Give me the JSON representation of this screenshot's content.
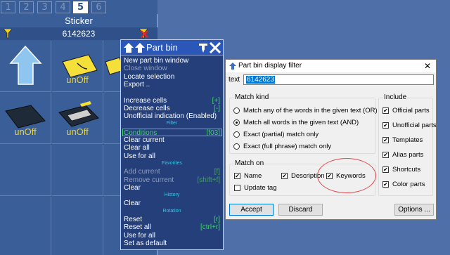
{
  "partbin": {
    "tabs": [
      "1",
      "2",
      "3",
      "4",
      "5",
      "6"
    ],
    "active_tab": "5",
    "title": "Sticker",
    "filter_text": "6142623",
    "cells": [
      {
        "caption": ""
      },
      {
        "caption": "unOff"
      },
      {
        "caption": ""
      },
      {
        "caption": "unOff"
      },
      {
        "caption": "unOff"
      }
    ]
  },
  "menu": {
    "title": "Part bin",
    "items": [
      {
        "label": "New part bin window",
        "shortcut": "",
        "state": "normal"
      },
      {
        "label": "Close window",
        "shortcut": "",
        "state": "disabled"
      },
      {
        "label": "Locate selection",
        "shortcut": "",
        "state": "normal"
      },
      {
        "label": "Export ..",
        "shortcut": "",
        "state": "normal"
      },
      {
        "label": "",
        "shortcut": "",
        "state": "blank"
      },
      {
        "label": "Increase cells",
        "shortcut": "[+]",
        "state": "normal"
      },
      {
        "label": "Decrease cells",
        "shortcut": "[-]",
        "state": "normal"
      },
      {
        "label": "Unofficial indication (Enabled)",
        "shortcut": "",
        "state": "normal"
      },
      {
        "label": "Filter",
        "shortcut": "",
        "state": "separator"
      },
      {
        "label": "Conditions",
        "shortcut": "[f03]",
        "state": "selected"
      },
      {
        "label": "Clear current",
        "shortcut": "",
        "state": "normal"
      },
      {
        "label": "Clear all",
        "shortcut": "",
        "state": "normal"
      },
      {
        "label": "Use for all",
        "shortcut": "",
        "state": "normal"
      },
      {
        "label": "Favorites",
        "shortcut": "",
        "state": "separator"
      },
      {
        "label": "Add current",
        "shortcut": "[f]",
        "state": "disabled"
      },
      {
        "label": "Remove current",
        "shortcut": "[shift+f]",
        "state": "disabled"
      },
      {
        "label": "Clear",
        "shortcut": "",
        "state": "normal"
      },
      {
        "label": "History",
        "shortcut": "",
        "state": "separator"
      },
      {
        "label": "Clear",
        "shortcut": "",
        "state": "normal"
      },
      {
        "label": "Rotation",
        "shortcut": "",
        "state": "separator"
      },
      {
        "label": "Reset",
        "shortcut": "[r]",
        "state": "normal"
      },
      {
        "label": "Reset all",
        "shortcut": "[ctrl+r]",
        "state": "normal"
      },
      {
        "label": "Use for all",
        "shortcut": "",
        "state": "normal"
      },
      {
        "label": "Set as default",
        "shortcut": "",
        "state": "normal"
      }
    ]
  },
  "dialog": {
    "title": "Part bin display filter",
    "text_label": "text",
    "text_value": "6142623",
    "match_kind": {
      "title": "Match kind",
      "options": [
        {
          "label": "Match any of the words in the given text  (OR)",
          "selected": false
        },
        {
          "label": "Match all words in the given text  (AND)",
          "selected": true
        },
        {
          "label": "Exact (partial) match only",
          "selected": false
        },
        {
          "label": "Exact (full phrase) match only",
          "selected": false
        }
      ]
    },
    "match_on": {
      "title": "Match on",
      "options": [
        {
          "label": "Name",
          "checked": true
        },
        {
          "label": "Description",
          "checked": true
        },
        {
          "label": "Keywords",
          "checked": true
        },
        {
          "label": "Update tag",
          "checked": false
        }
      ]
    },
    "include": {
      "title": "Include",
      "options": [
        {
          "label": "Official parts",
          "checked": true
        },
        {
          "label": "Unofficial parts",
          "checked": true
        },
        {
          "label": "Templates",
          "checked": true
        },
        {
          "label": "Alias parts",
          "checked": true
        },
        {
          "label": "Shortcuts",
          "checked": true
        },
        {
          "label": "Color parts",
          "checked": true
        }
      ]
    },
    "buttons": {
      "accept": "Accept",
      "discard": "Discard",
      "options": "Options ..."
    },
    "close_glyph": "✕",
    "check_glyph": "✔"
  },
  "colors": {
    "panel_bg": "#3a5f98",
    "caption_yellow": "#f2d21b",
    "menu_green": "#3ad85a",
    "menu_separator": "#37c8e8",
    "annotation_red": "#e04a4a"
  }
}
